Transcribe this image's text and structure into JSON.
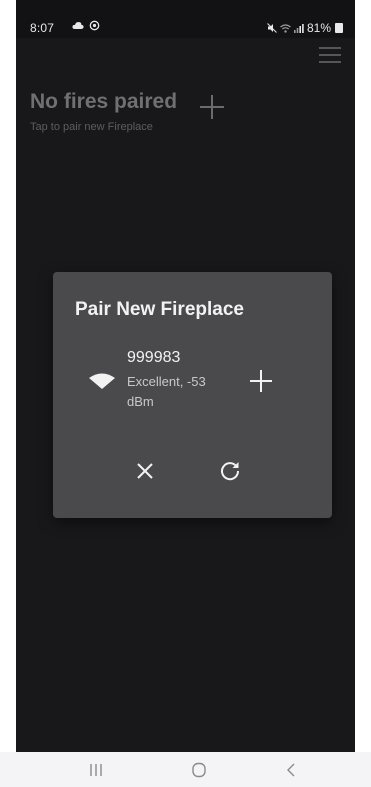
{
  "status_bar": {
    "time": "8:07",
    "battery": "81%"
  },
  "header": {
    "title": "No fires paired",
    "subtitle": "Tap to pair new Fireplace"
  },
  "dialog": {
    "title": "Pair New Fireplace",
    "network": {
      "name": "999983",
      "signal": "Excellent, -53 dBm"
    }
  },
  "icons": {
    "menu": "hamburger-menu-icon",
    "add": "plus-icon",
    "wifi": "wifi-icon",
    "close": "close-icon",
    "refresh": "refresh-icon",
    "nav_recents": "recents-icon",
    "nav_home": "home-icon",
    "nav_back": "back-icon"
  },
  "colors": {
    "background": "#18181a",
    "dialog": "#4a4a4d",
    "muted_text": "#6f6f74",
    "nav_bar": "#f4f4f6"
  }
}
